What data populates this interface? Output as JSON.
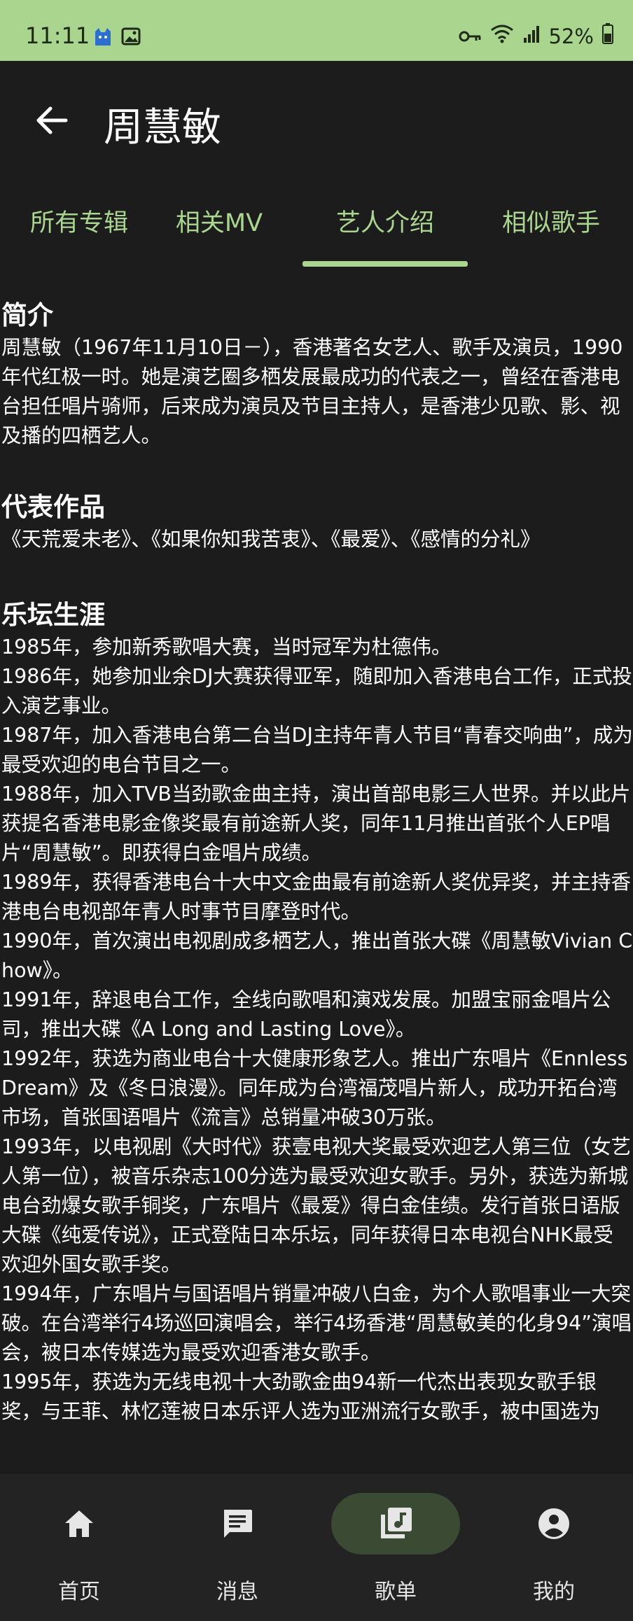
{
  "status_bar": {
    "time": "11:11",
    "battery": "52%",
    "icons_left": [
      "cat-app-icon",
      "image-icon"
    ],
    "icons_right": [
      "key-icon",
      "wifi-icon",
      "signal-icon",
      "battery-icon"
    ]
  },
  "header": {
    "title": "周慧敏"
  },
  "tabs": [
    {
      "label": "所有专辑",
      "selected": false
    },
    {
      "label": "相关MV",
      "selected": false
    },
    {
      "label": "艺人介绍",
      "selected": true
    },
    {
      "label": "相似歌手",
      "selected": false
    }
  ],
  "sections": {
    "intro_title": "简介",
    "intro_text": "周慧敏（1967年11月10日－），香港著名女艺人、歌手及演员，1990年代红极一时。她是演艺圈多栖发展最成功的代表之一，曾经在香港电台担任唱片骑师，后来成为演员及节目主持人，是香港少见歌、影、视及播的四栖艺人。",
    "works_title": "代表作品",
    "works_text": "《天荒爱未老》、《如果你知我苦衷》、《最爱》、《感情的分礼》",
    "career_title": "乐坛生涯",
    "career_text": "1985年，参加新秀歌唱大赛，当时冠军为杜德伟。\n1986年，她参加业余DJ大赛获得亚军，随即加入香港电台工作，正式投入演艺事业。\n1987年，加入香港电台第二台当DJ主持年青人节目“青春交响曲”，成为最受欢迎的电台节目之一。\n1988年，加入TVB当劲歌金曲主持，演出首部电影三人世界。并以此片获提名香港电影金像奖最有前途新人奖，同年11月推出首张个人EP唱片“周慧敏”。即获得白金唱片成绩。\n1989年，获得香港电台十大中文金曲最有前途新人奖优异奖，并主持香港电台电视部年青人时事节目摩登时代。\n1990年，首次演出电视剧成多栖艺人，推出首张大碟《周慧敏Vivian Chow》。\n1991年，辞退电台工作，全线向歌唱和演戏发展。加盟宝丽金唱片公司，推出大碟《A Long and Lasting Love》。\n1992年，获选为商业电台十大健康形象艺人。推出广东唱片《Ennless Dream》及《冬日浪漫》。同年成为台湾福茂唱片新人，成功开拓台湾市场，首张国语唱片《流言》总销量冲破30万张。\n1993年，以电视剧《大时代》获壹电视大奖最受欢迎艺人第三位（女艺人第一位），被音乐杂志100分选为最受欢迎女歌手。另外，获选为新城电台劲爆女歌手铜奖，广东唱片《最爱》得白金佳绩。发行首张日语版大碟《纯爱传说》，正式登陆日本乐坛，同年获得日本电视台NHK最受欢迎外国女歌手奖。\n1994年，广东唱片与国语唱片销量冲破八白金，为个人歌唱事业一大突破。在台湾举行4场巡回演唱会，举行4场香港“周慧敏美的化身94”演唱会，被日本传媒选为最受欢迎香港女歌手。\n1995年，获选为无线电视十大劲歌金曲94新一代杰出表现女歌手银奖，与王菲、林忆莲被日本乐评人选为亚洲流行女歌手，被中国选为"
  },
  "bottom_nav": [
    {
      "label": "首页",
      "icon": "home-icon",
      "active": false
    },
    {
      "label": "消息",
      "icon": "message-icon",
      "active": false
    },
    {
      "label": "歌单",
      "icon": "playlist-icon",
      "active": true
    },
    {
      "label": "我的",
      "icon": "profile-icon",
      "active": false
    }
  ],
  "colors": {
    "accent": "#a9d58f",
    "background": "#1c1c1c",
    "nav_background": "#232323",
    "active_pill": "#3a4a33"
  }
}
